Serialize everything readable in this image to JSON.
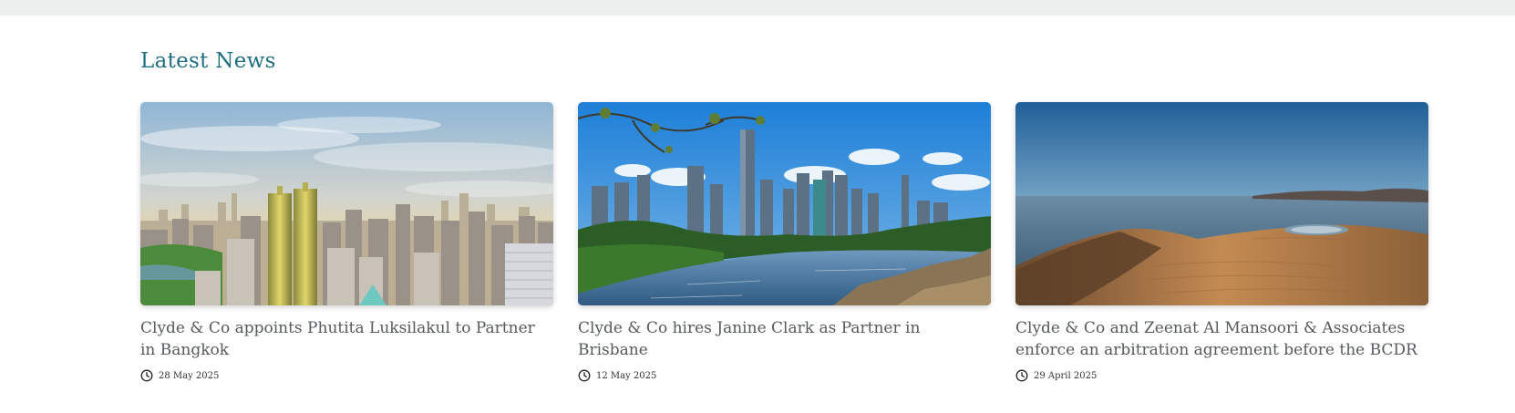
{
  "section": {
    "title": "Latest News"
  },
  "articles": [
    {
      "title": "Clyde & Co appoints Phutita Luksilakul to Partner in Bangkok",
      "date": "28 May 2025",
      "image": "bangkok-skyline-photo"
    },
    {
      "title": "Clyde & Co hires Janine Clark as Partner in Brisbane",
      "date": "12 May 2025",
      "image": "brisbane-river-skyline-photo"
    },
    {
      "title": "Clyde & Co and Zeenat Al Mansoori & Associates enforce an arbitration agreement before the BCDR",
      "date": "29 April 2025",
      "image": "desert-dune-sea-photo"
    }
  ],
  "icons": {
    "date": "clock-icon"
  },
  "colors": {
    "title": "#1f6e82",
    "card_title": "#555a5c",
    "top_bar": "#eceeed"
  }
}
